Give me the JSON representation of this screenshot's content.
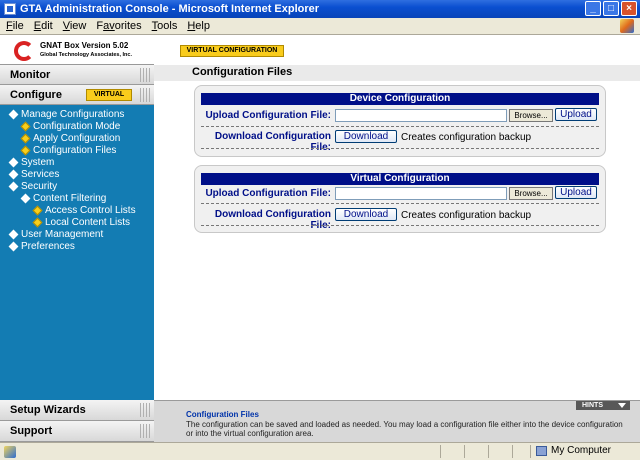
{
  "window": {
    "title": "GTA Administration Console - Microsoft Internet Explorer",
    "minimize": "_",
    "maximize": "□",
    "close": "×"
  },
  "menu": [
    {
      "key": "F",
      "rest": "ile"
    },
    {
      "key": "E",
      "rest": "dit"
    },
    {
      "key": "V",
      "rest": "iew"
    },
    {
      "key": "F",
      "rest": "av",
      "tail": "orites"
    },
    {
      "key": "T",
      "rest": "ools"
    },
    {
      "key": "H",
      "rest": "elp"
    }
  ],
  "logo": {
    "title": "GNAT Box Version 5.02",
    "subtitle": "Global Technology Associates, Inc."
  },
  "sidebar": {
    "monitor": "Monitor",
    "configure": "Configure",
    "virtual_badge": "VIRTUAL",
    "tree": [
      {
        "label": "Manage Configurations",
        "level": 0,
        "type": "plus"
      },
      {
        "label": "Configuration Mode",
        "level": 1,
        "type": "leaf"
      },
      {
        "label": "Apply Configuration",
        "level": 1,
        "type": "leaf"
      },
      {
        "label": "Configuration Files",
        "level": 1,
        "type": "leaf"
      },
      {
        "label": "System",
        "level": 0,
        "type": "plus"
      },
      {
        "label": "Services",
        "level": 0,
        "type": "plus"
      },
      {
        "label": "Security",
        "level": 0,
        "type": "plus"
      },
      {
        "label": "Content Filtering",
        "level": 1,
        "type": "plus"
      },
      {
        "label": "Access Control Lists",
        "level": 2,
        "type": "leaf"
      },
      {
        "label": "Local Content Lists",
        "level": 2,
        "type": "leaf"
      },
      {
        "label": "User Management",
        "level": 0,
        "type": "plus"
      },
      {
        "label": "Preferences",
        "level": 0,
        "type": "plus"
      }
    ],
    "setup_wizards": "Setup Wizards",
    "support": "Support"
  },
  "main": {
    "virtual_tag": "VIRTUAL CONFIGURATION",
    "page_title": "Configuration Files",
    "panels": [
      {
        "heading": "Device Configuration",
        "upload_label": "Upload Configuration File:",
        "browse": "Browse...",
        "upload_button": "Upload",
        "download_label": "Download Configuration File:",
        "download_button": "Download",
        "download_note": "Creates configuration backup"
      },
      {
        "heading": "Virtual Configuration",
        "upload_label": "Upload Configuration File:",
        "browse": "Browse...",
        "upload_button": "Upload",
        "download_label": "Download Configuration File:",
        "download_button": "Download",
        "download_note": "Creates configuration backup"
      }
    ]
  },
  "hints": {
    "tab": "HINTS",
    "title": "Configuration Files",
    "text": "The configuration can be saved and loaded as needed. You may load a configuration file either into the device configuration or into the virtual configuration area."
  },
  "status": {
    "zone": "My Computer"
  }
}
